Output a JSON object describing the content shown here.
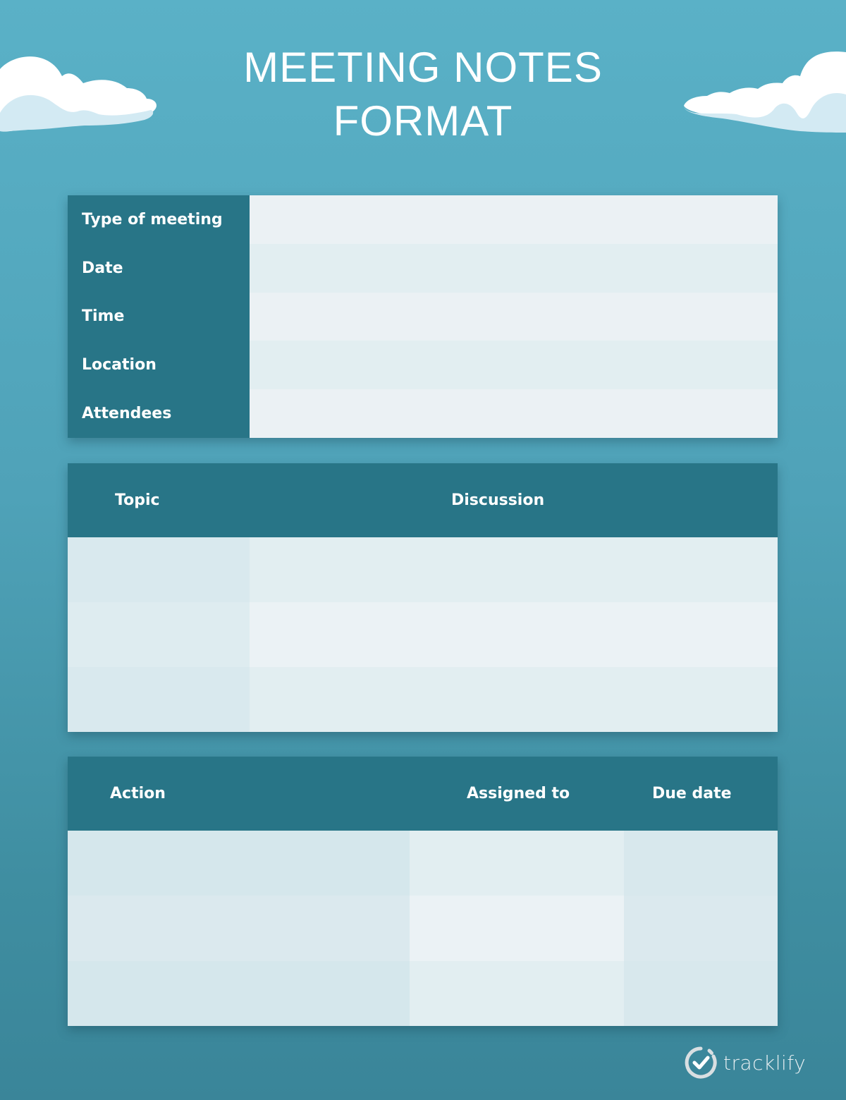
{
  "page": {
    "title_line1": "MEETING NOTES",
    "title_line2": "FORMAT"
  },
  "colors": {
    "background_top": "#5ab1c7",
    "background_bottom": "#3a8599",
    "header_teal": "#287587",
    "cell_light": "#ebf1f4",
    "cell_mid": "#e2eef1",
    "cell_dark": "#d6e7ec",
    "text": "#ffffff"
  },
  "meeting_info": {
    "fields": [
      {
        "label": "Type of meeting",
        "value": ""
      },
      {
        "label": "Date",
        "value": ""
      },
      {
        "label": "Time",
        "value": ""
      },
      {
        "label": "Location",
        "value": ""
      },
      {
        "label": "Attendees",
        "value": ""
      }
    ]
  },
  "discussion_table": {
    "headers": [
      "Topic",
      "Discussion"
    ],
    "rows": [
      [
        "",
        ""
      ],
      [
        "",
        ""
      ],
      [
        "",
        ""
      ]
    ]
  },
  "action_table": {
    "headers": [
      "Action",
      "Assigned to",
      "Due date"
    ],
    "rows": [
      [
        "",
        "",
        ""
      ],
      [
        "",
        "",
        ""
      ],
      [
        "",
        "",
        ""
      ]
    ]
  },
  "brand": {
    "name": "tracklify",
    "icon": "clock-check-icon"
  },
  "decorations": {
    "left_icon": "cloud-icon",
    "right_icon": "cloud-icon"
  }
}
